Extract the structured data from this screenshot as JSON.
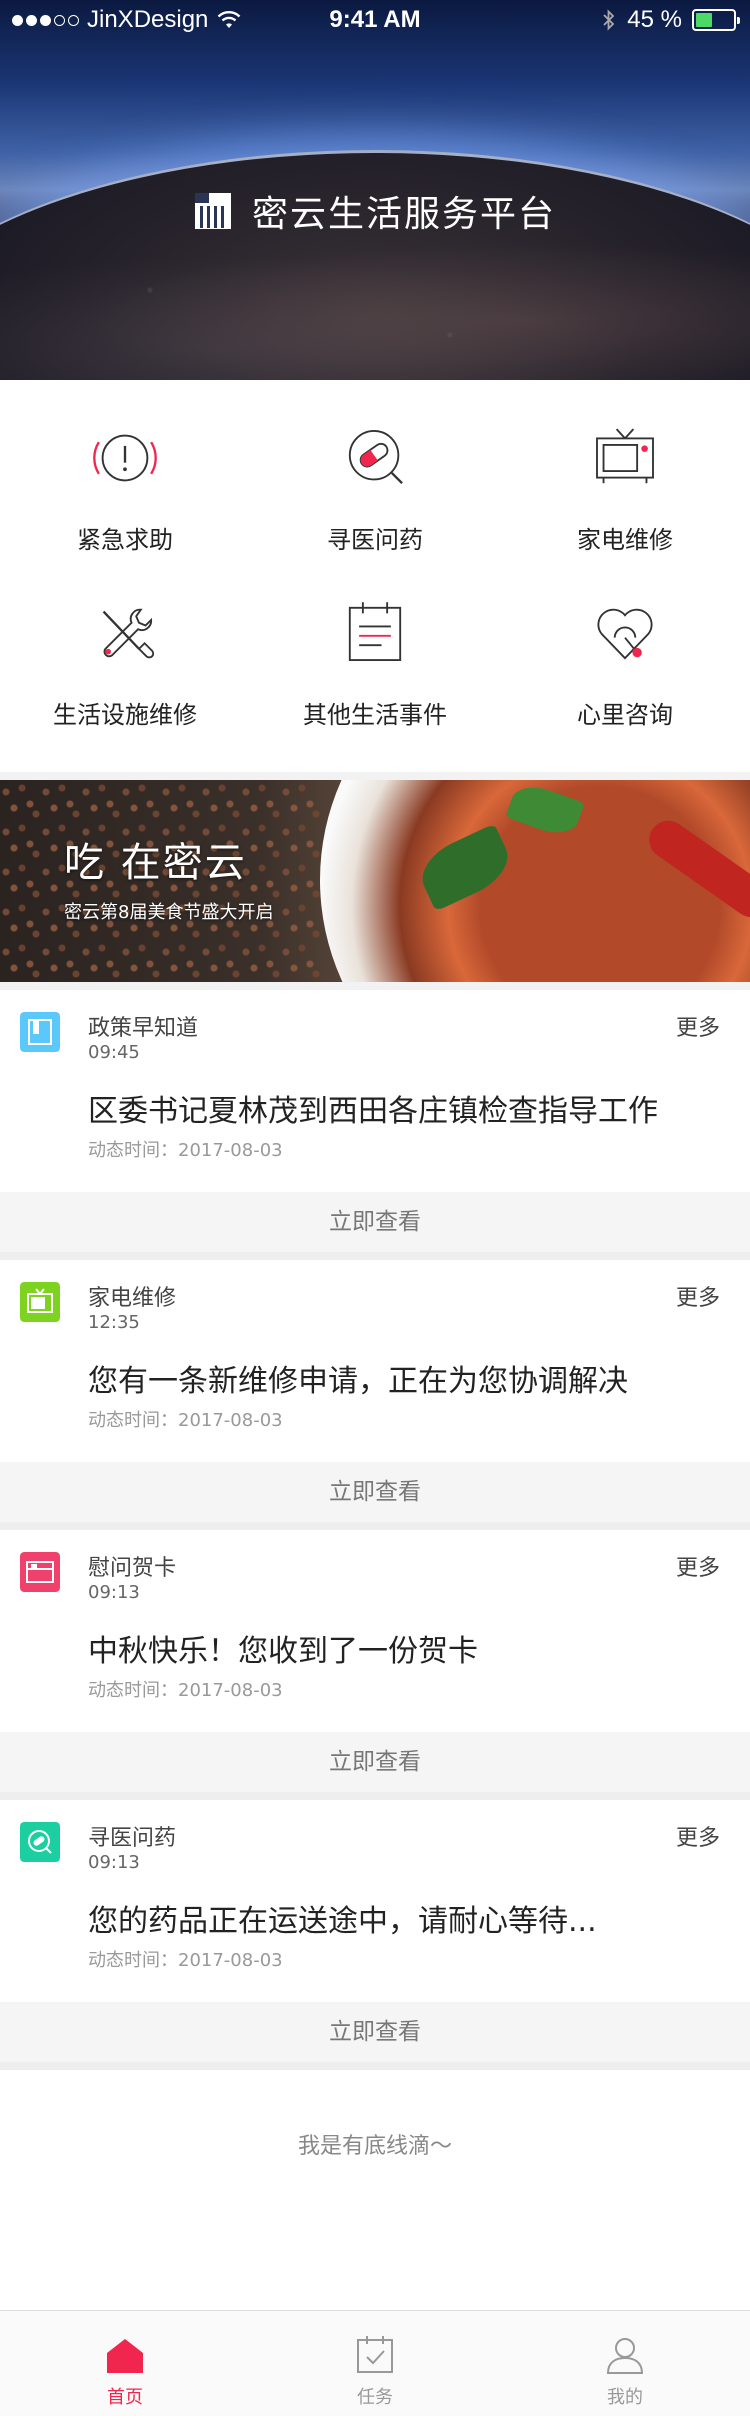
{
  "status_bar": {
    "carrier": "JinXDesign",
    "time": "9:41 AM",
    "battery_text": "45 %",
    "battery_level": 0.45,
    "signal_bars": 3,
    "signal_total": 5
  },
  "hero": {
    "title": "密云生活服务平台"
  },
  "services": [
    {
      "label": "紧急求助",
      "icon": "alert-icon"
    },
    {
      "label": "寻医问药",
      "icon": "pill-icon"
    },
    {
      "label": "家电维修",
      "icon": "tv-icon"
    },
    {
      "label": "生活设施维修",
      "icon": "tools-icon"
    },
    {
      "label": "其他生活事件",
      "icon": "calendar-icon"
    },
    {
      "label": "心里咨询",
      "icon": "heart-phone-icon"
    }
  ],
  "banner": {
    "title": "吃 在密云",
    "subtitle": "密云第8届美食节盛大开启"
  },
  "feed": [
    {
      "category": "政策早知道",
      "time": "09:45",
      "more": "更多",
      "headline": "区委书记夏林茂到西田各庄镇检查指导工作",
      "date": "动态时间：2017-08-03",
      "cta": "立即查看",
      "icon": "policy-icon",
      "color": "#5ac8fa"
    },
    {
      "category": "家电维修",
      "time": "12:35",
      "more": "更多",
      "headline": "您有一条新维修申请，正在为您协调解决",
      "date": "动态时间：2017-08-03",
      "cta": "立即查看",
      "icon": "repair-icon",
      "color": "#7ed321"
    },
    {
      "category": "慰问贺卡",
      "time": "09:13",
      "more": "更多",
      "headline": "中秋快乐！您收到了一份贺卡",
      "date": "动态时间：2017-08-03",
      "cta": "立即查看",
      "icon": "card-icon",
      "color": "#f0416c"
    },
    {
      "category": "寻医问药",
      "time": "09:13",
      "more": "更多",
      "headline": "您的药品正在运送途中，请耐心等待...",
      "date": "动态时间：2017-08-03",
      "cta": "立即查看",
      "icon": "medicine-icon",
      "color": "#1ccfa0"
    }
  ],
  "footer_note": "我是有底线滴～",
  "tabbar": [
    {
      "label": "首页",
      "icon": "home-icon",
      "active": true
    },
    {
      "label": "任务",
      "icon": "task-icon",
      "active": false
    },
    {
      "label": "我的",
      "icon": "profile-icon",
      "active": false
    }
  ],
  "colors": {
    "accent": "#f0264f",
    "text": "#222222",
    "muted": "#999999"
  }
}
